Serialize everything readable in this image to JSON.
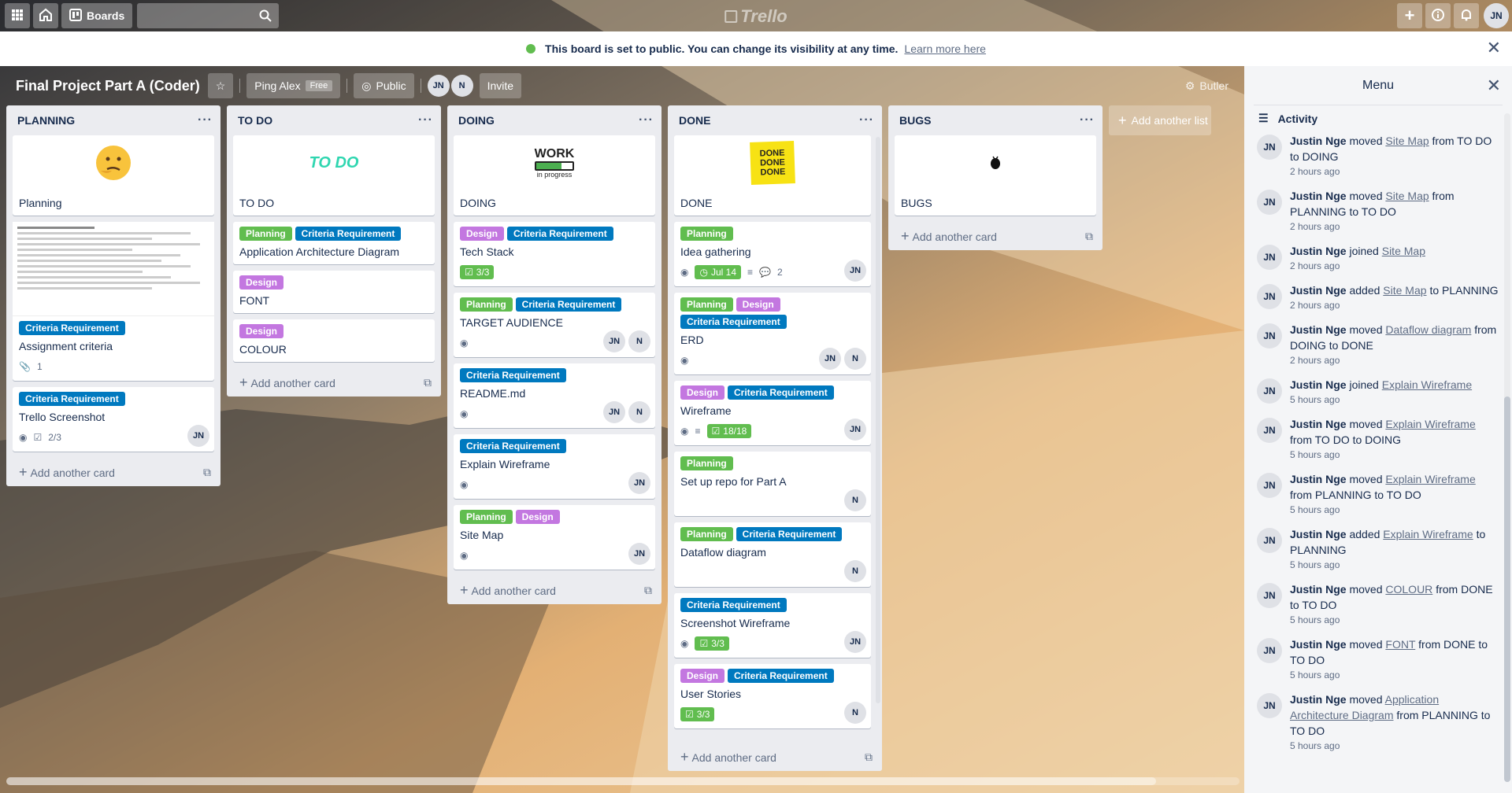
{
  "topbar": {
    "boards_label": "Boards",
    "logo_text": "Trello",
    "user_initials": "JN"
  },
  "notice": {
    "message": "This board is set to public. You can change its visibility at any time.",
    "link": "Learn more here"
  },
  "board": {
    "title": "Final Project Part A (Coder)",
    "team": "Ping Alex",
    "team_badge": "Free",
    "visibility": "Public",
    "members": [
      "JN",
      "N"
    ],
    "invite_label": "Invite",
    "butler_label": "Butler",
    "add_list_label": "Add another list"
  },
  "colors": {
    "label_green": "#61bd4f",
    "label_blue": "#0079bf",
    "label_purple": "#c377e0",
    "list_bg": "#ebecf0"
  },
  "add_card_label": "Add another card",
  "lists": [
    {
      "name": "PLANNING",
      "cards": [
        {
          "title": "Planning",
          "cover": "thinking-face"
        },
        {
          "title": "Assignment criteria",
          "labels": [
            "Criteria Requirement"
          ],
          "attachments": "1"
        },
        {
          "title": "Trello Screenshot",
          "labels": [
            "Criteria Requirement"
          ],
          "checklist": "2/3",
          "members": [
            "JN"
          ]
        }
      ]
    },
    {
      "name": "TO DO",
      "cards": [
        {
          "title": "TO DO",
          "cover_text": "TO DO"
        },
        {
          "title": "Application Architecture Diagram",
          "labels": [
            "Planning",
            "Criteria Requirement"
          ]
        },
        {
          "title": "FONT",
          "labels": [
            "Design"
          ]
        },
        {
          "title": "COLOUR",
          "labels": [
            "Design"
          ]
        }
      ]
    },
    {
      "name": "DOING",
      "cards": [
        {
          "title": "DOING",
          "cover_text": "WORK",
          "cover_sub": "in progress"
        },
        {
          "title": "Tech Stack",
          "labels": [
            "Design",
            "Criteria Requirement"
          ],
          "checklist": "3/3"
        },
        {
          "title": "TARGET AUDIENCE",
          "labels": [
            "Planning",
            "Criteria Requirement"
          ],
          "members": [
            "JN",
            "N"
          ]
        },
        {
          "title": "README.md",
          "labels": [
            "Criteria Requirement"
          ],
          "members": [
            "JN",
            "N"
          ]
        },
        {
          "title": "Explain Wireframe",
          "labels": [
            "Criteria Requirement"
          ],
          "members": [
            "JN"
          ]
        },
        {
          "title": "Site Map",
          "labels": [
            "Planning",
            "Design"
          ],
          "members": [
            "JN"
          ]
        }
      ]
    },
    {
      "name": "DONE",
      "cards": [
        {
          "title": "DONE",
          "cover_text": "DONE DONE DONE"
        },
        {
          "title": "Idea gathering",
          "labels": [
            "Planning"
          ],
          "due": "Jul 14",
          "comments": "2",
          "members": [
            "JN"
          ]
        },
        {
          "title": "ERD",
          "labels": [
            "Planning",
            "Design",
            "Criteria Requirement"
          ],
          "members": [
            "JN",
            "N"
          ]
        },
        {
          "title": "Wireframe",
          "labels": [
            "Design",
            "Criteria Requirement"
          ],
          "checklist": "18/18",
          "members": [
            "JN"
          ]
        },
        {
          "title": "Set up repo for Part A",
          "labels": [
            "Planning"
          ],
          "members": [
            "N"
          ]
        },
        {
          "title": "Dataflow diagram",
          "labels": [
            "Planning",
            "Criteria Requirement"
          ],
          "members": [
            "N"
          ]
        },
        {
          "title": "Screenshot Wireframe",
          "labels": [
            "Criteria Requirement"
          ],
          "checklist": "3/3",
          "members": [
            "JN"
          ]
        },
        {
          "title": "User Stories",
          "labels": [
            "Design",
            "Criteria Requirement"
          ],
          "checklist": "3/3",
          "members": [
            "N"
          ]
        }
      ]
    },
    {
      "name": "BUGS",
      "cards": [
        {
          "title": "BUGS",
          "cover": "bug"
        }
      ]
    }
  ],
  "menu": {
    "title": "Menu",
    "activity_title": "Activity",
    "activities": [
      {
        "user": "Justin Nge",
        "initials": "JN",
        "pre": "moved",
        "target": "Site Map",
        "post": "from TO DO to DOING",
        "time": "2 hours ago"
      },
      {
        "user": "Justin Nge",
        "initials": "JN",
        "pre": "moved",
        "target": "Site Map",
        "post": "from PLANNING to TO DO",
        "time": "2 hours ago"
      },
      {
        "user": "Justin Nge",
        "initials": "JN",
        "pre": "joined",
        "target": "Site Map",
        "post": "",
        "time": "2 hours ago"
      },
      {
        "user": "Justin Nge",
        "initials": "JN",
        "pre": "added",
        "target": "Site Map",
        "post": "to PLANNING",
        "time": "2 hours ago"
      },
      {
        "user": "Justin Nge",
        "initials": "JN",
        "pre": "moved",
        "target": "Dataflow diagram",
        "post": "from DOING to DONE",
        "time": "2 hours ago"
      },
      {
        "user": "Justin Nge",
        "initials": "JN",
        "pre": "joined",
        "target": "Explain Wireframe",
        "post": "",
        "time": "5 hours ago"
      },
      {
        "user": "Justin Nge",
        "initials": "JN",
        "pre": "moved",
        "target": "Explain Wireframe",
        "post": "from TO DO to DOING",
        "time": "5 hours ago"
      },
      {
        "user": "Justin Nge",
        "initials": "JN",
        "pre": "moved",
        "target": "Explain Wireframe",
        "post": "from PLANNING to TO DO",
        "time": "5 hours ago"
      },
      {
        "user": "Justin Nge",
        "initials": "JN",
        "pre": "added",
        "target": "Explain Wireframe",
        "post": "to PLANNING",
        "time": "5 hours ago"
      },
      {
        "user": "Justin Nge",
        "initials": "JN",
        "pre": "moved",
        "target": "COLOUR",
        "post": "from DONE to TO DO",
        "time": "5 hours ago"
      },
      {
        "user": "Justin Nge",
        "initials": "JN",
        "pre": "moved",
        "target": "FONT",
        "post": "from DONE to TO DO",
        "time": "5 hours ago"
      },
      {
        "user": "Justin Nge",
        "initials": "JN",
        "pre": "moved",
        "target": "Application Architecture Diagram",
        "post": "from PLANNING to TO DO",
        "time": "5 hours ago"
      }
    ]
  }
}
